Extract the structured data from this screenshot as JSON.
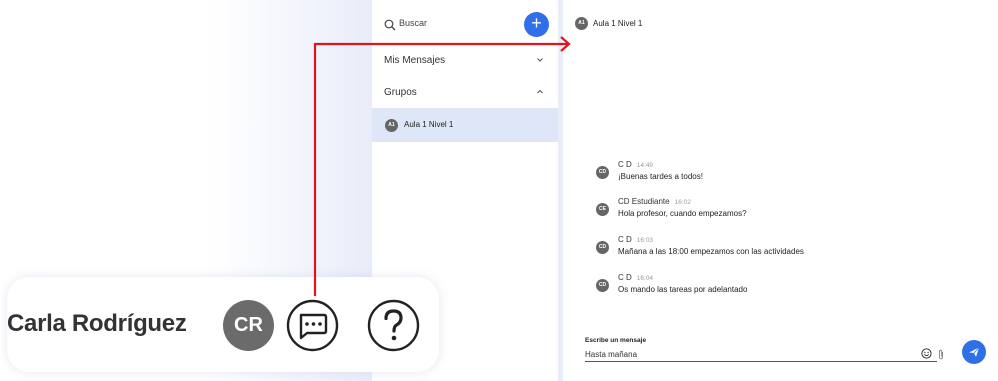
{
  "sidebar": {
    "search_label": "Buscar",
    "add_label": "+",
    "sections": [
      {
        "label": "Mis Mensajes",
        "expanded": false
      },
      {
        "label": "Grupos",
        "expanded": true
      }
    ],
    "groups": [
      {
        "avatar": "A1",
        "label": "Aula 1 Nivel 1",
        "selected": true
      }
    ]
  },
  "chat": {
    "header": {
      "avatar": "A1",
      "title": "Aula 1 Nivel 1"
    },
    "messages": [
      {
        "avatar": "CD",
        "author": "C D",
        "time": "14:49",
        "text": "¡Buenas tardes a todos!"
      },
      {
        "avatar": "CE",
        "author": "CD Estudiante",
        "time": "16:02",
        "text": "Hola profesor, cuando empezamos?"
      },
      {
        "avatar": "CD",
        "author": "C D",
        "time": "16:03",
        "text": "Mañana a las 18:00 empezamos con las actividades"
      },
      {
        "avatar": "CD",
        "author": "C D",
        "time": "16:04",
        "text": "Os mando las tareas por adelantado"
      }
    ],
    "compose": {
      "label": "Escribe un mensaje",
      "value": "Hasta mañana"
    }
  },
  "callout": {
    "user_name": "Carla Rodríguez",
    "avatar": "CR",
    "icons": [
      "chat-icon",
      "help-icon"
    ]
  },
  "colors": {
    "accent": "#2f6fe8",
    "selected_bg": "#dfe6f7",
    "arrow": "#e0141e",
    "avatar": "#666666"
  }
}
